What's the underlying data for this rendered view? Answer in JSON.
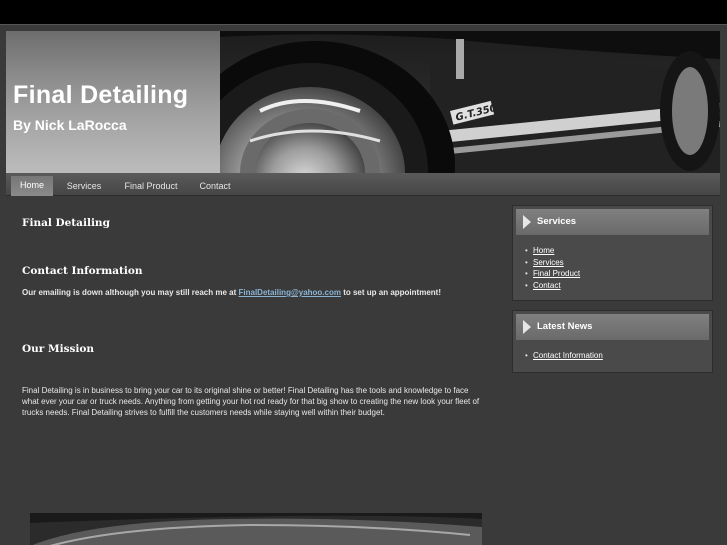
{
  "header": {
    "title": "Final Detailing",
    "subtitle": "By Nick LaRocca",
    "photo_icon": "car-wheel-photo"
  },
  "nav": {
    "items": [
      {
        "label": "Home",
        "active": true
      },
      {
        "label": "Services",
        "active": false
      },
      {
        "label": "Final Product",
        "active": false
      },
      {
        "label": "Contact",
        "active": false
      }
    ]
  },
  "main": {
    "page_heading": "Final Detailing",
    "contact_heading": "Contact Information",
    "contact_text_before": "Our emailing is down although you may still reach me at ",
    "contact_email": "FinalDetailing@yahoo.com",
    "contact_text_after": " to set up an appointment!",
    "mission_heading": "Our Mission",
    "mission_text": "Final Detailing is in business to bring your car to its original shine or better! Final Detailing has the tools and knowledge to face what ever your car or truck needs. Anything from getting your hot rod ready for that big show to creating the new look your fleet of trucks needs. Final Detailing strives to fulfill the customers needs while staying well within their budget."
  },
  "sidebar": {
    "services": {
      "title": "Services",
      "links": [
        "Home",
        "Services",
        "Final Product",
        "Contact"
      ]
    },
    "news": {
      "title": "Latest News",
      "links": [
        "Contact Information"
      ]
    }
  },
  "colors": {
    "page_bg": "#3a3a3a",
    "link": "#8ab4d6",
    "text": "#e8e8e8"
  }
}
